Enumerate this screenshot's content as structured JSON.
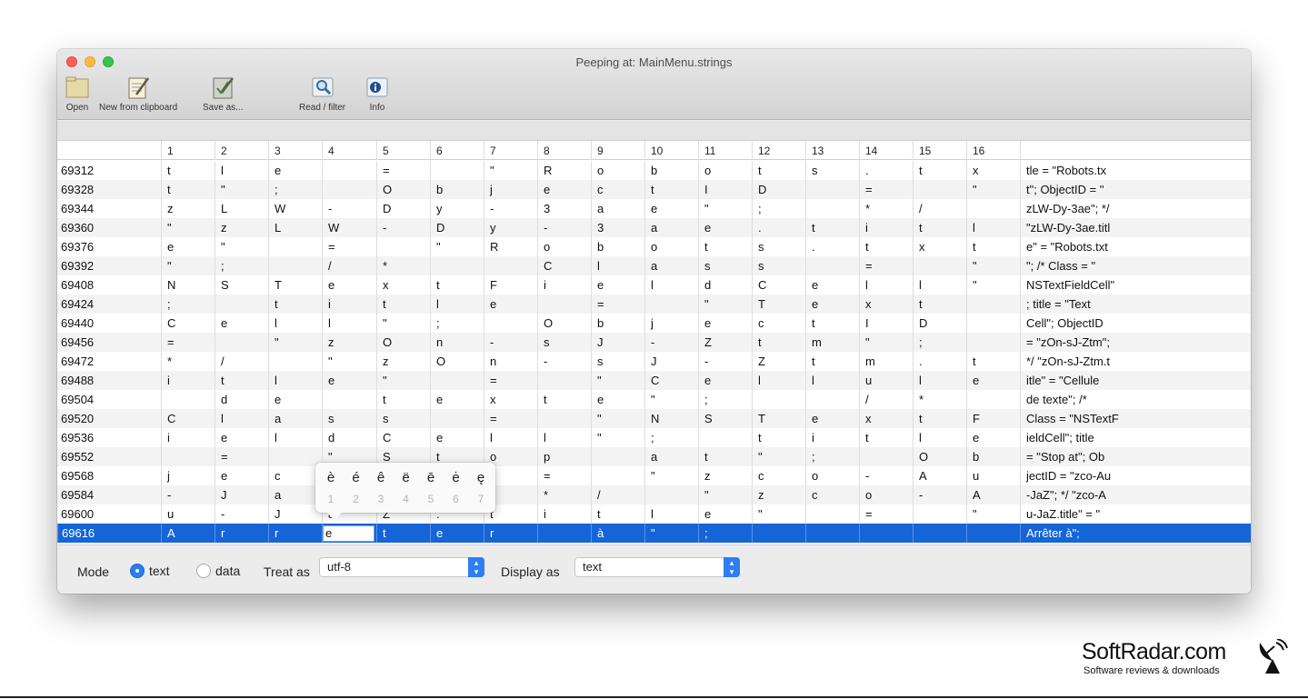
{
  "window": {
    "title": "Peeping at: MainMenu.strings"
  },
  "toolbar": [
    {
      "label": "Open",
      "icon": "folder-icon"
    },
    {
      "label": "New from clipboard",
      "icon": "new-note-icon"
    },
    {
      "label": "Save as...",
      "icon": "save-note-icon"
    },
    {
      "label": "Read / filter",
      "icon": "magnifier-icon"
    },
    {
      "label": "Info",
      "icon": "info-icon"
    }
  ],
  "table": {
    "columns": [
      "",
      "1",
      "2",
      "3",
      "4",
      "5",
      "6",
      "7",
      "8",
      "9",
      "10",
      "11",
      "12",
      "13",
      "14",
      "15",
      "16",
      ""
    ],
    "rows": [
      {
        "offset": "69312",
        "bytes": [
          "t",
          "l",
          "e",
          "",
          "=",
          "",
          "\"",
          "R",
          "o",
          "b",
          "o",
          "t",
          "s",
          ".",
          "t",
          "x"
        ],
        "text": "tle = \"Robots.tx"
      },
      {
        "offset": "69328",
        "bytes": [
          "t",
          "\"",
          ";",
          "",
          "O",
          "b",
          "j",
          "e",
          "c",
          "t",
          "I",
          "D",
          "",
          "=",
          "",
          "\""
        ],
        "text": "t\"; ObjectID = \""
      },
      {
        "offset": "69344",
        "bytes": [
          "z",
          "L",
          "W",
          "-",
          "D",
          "y",
          "-",
          "3",
          "a",
          "e",
          "\"",
          ";",
          "",
          "*",
          "/",
          ""
        ],
        "text": "zLW-Dy-3ae\"; */"
      },
      {
        "offset": "69360",
        "bytes": [
          "\"",
          "z",
          "L",
          "W",
          "-",
          "D",
          "y",
          "-",
          "3",
          "a",
          "e",
          ".",
          "t",
          "i",
          "t",
          "l"
        ],
        "text": "\"zLW-Dy-3ae.titl"
      },
      {
        "offset": "69376",
        "bytes": [
          "e",
          "\"",
          "",
          "=",
          "",
          "\"",
          "R",
          "o",
          "b",
          "o",
          "t",
          "s",
          ".",
          "t",
          "x",
          "t"
        ],
        "text": "e\" = \"Robots.txt"
      },
      {
        "offset": "69392",
        "bytes": [
          "\"",
          ";",
          "",
          "/",
          "*",
          "",
          "",
          "C",
          "l",
          "a",
          "s",
          "s",
          "",
          "=",
          "",
          "\""
        ],
        "text": "\";  /* Class = \""
      },
      {
        "offset": "69408",
        "bytes": [
          "N",
          "S",
          "T",
          "e",
          "x",
          "t",
          "F",
          "i",
          "e",
          "l",
          "d",
          "C",
          "e",
          "l",
          "l",
          "\""
        ],
        "text": "NSTextFieldCell\""
      },
      {
        "offset": "69424",
        "bytes": [
          ";",
          "",
          "t",
          "i",
          "t",
          "l",
          "e",
          "",
          "=",
          "",
          "\"",
          "T",
          "e",
          "x",
          "t",
          ""
        ],
        "text": "; title = \"Text"
      },
      {
        "offset": "69440",
        "bytes": [
          "C",
          "e",
          "l",
          "l",
          "\"",
          ";",
          "",
          "O",
          "b",
          "j",
          "e",
          "c",
          "t",
          "I",
          "D",
          ""
        ],
        "text": "Cell\"; ObjectID"
      },
      {
        "offset": "69456",
        "bytes": [
          "=",
          "",
          "\"",
          "z",
          "O",
          "n",
          "-",
          "s",
          "J",
          "-",
          "Z",
          "t",
          "m",
          "\"",
          ";",
          ""
        ],
        "text": "= \"zOn-sJ-Ztm\";"
      },
      {
        "offset": "69472",
        "bytes": [
          "*",
          "/",
          "",
          "\"",
          "z",
          "O",
          "n",
          "-",
          "s",
          "J",
          "-",
          "Z",
          "t",
          "m",
          ".",
          "t"
        ],
        "text": "*/ \"zOn-sJ-Ztm.t"
      },
      {
        "offset": "69488",
        "bytes": [
          "i",
          "t",
          "l",
          "e",
          "\"",
          "",
          "=",
          "",
          "\"",
          "C",
          "e",
          "l",
          "l",
          "u",
          "l",
          "e"
        ],
        "text": "itle\" = \"Cellule"
      },
      {
        "offset": "69504",
        "bytes": [
          "",
          "d",
          "e",
          "",
          "t",
          "e",
          "x",
          "t",
          "e",
          "\"",
          ";",
          "",
          "",
          "/",
          "*",
          ""
        ],
        "text": " de texte\";  /*"
      },
      {
        "offset": "69520",
        "bytes": [
          "C",
          "l",
          "a",
          "s",
          "s",
          "",
          "=",
          "",
          "\"",
          "N",
          "S",
          "T",
          "e",
          "x",
          "t",
          "F"
        ],
        "text": "Class = \"NSTextF"
      },
      {
        "offset": "69536",
        "bytes": [
          "i",
          "e",
          "l",
          "d",
          "C",
          "e",
          "l",
          "l",
          "\"",
          ";",
          "",
          "t",
          "i",
          "t",
          "l",
          "e"
        ],
        "text": "ieldCell\"; title"
      },
      {
        "offset": "69552",
        "bytes": [
          "",
          "=",
          "",
          "\"",
          "S",
          "t",
          "o",
          "p",
          "",
          "a",
          "t",
          "\"",
          ";",
          "",
          "O",
          "b"
        ],
        "text": " = \"Stop at\"; Ob"
      },
      {
        "offset": "69568",
        "bytes": [
          "j",
          "e",
          "c",
          "t",
          "I",
          "D",
          "",
          "=",
          "",
          "\"",
          "z",
          "c",
          "o",
          "-",
          "A",
          "u"
        ],
        "text": "jectID = \"zco-Au"
      },
      {
        "offset": "69584",
        "bytes": [
          "-",
          "J",
          "a",
          "Z",
          "\"",
          ";",
          "",
          "*",
          "/",
          "",
          "\"",
          "z",
          "c",
          "o",
          "-",
          "A"
        ],
        "text": "-JaZ\"; */ \"zco-A"
      },
      {
        "offset": "69600",
        "bytes": [
          "u",
          "-",
          "J",
          "a",
          "Z",
          ".",
          "t",
          "i",
          "t",
          "l",
          "e",
          "\"",
          "",
          "=",
          "",
          "\""
        ],
        "text": "u-JaZ.title\" = \""
      },
      {
        "offset": "69616",
        "bytes": [
          "A",
          "r",
          "r",
          "e",
          "t",
          "e",
          "r",
          "",
          "à",
          "\"",
          ";",
          "",
          "",
          "",
          "",
          ""
        ],
        "text": "Arrêter à\";"
      }
    ]
  },
  "accent_popup": {
    "chars": [
      "è",
      "é",
      "ê",
      "ë",
      "ē",
      "ė",
      "ę"
    ],
    "keys": [
      "1",
      "2",
      "3",
      "4",
      "5",
      "6",
      "7"
    ]
  },
  "controls": {
    "mode_label": "Mode",
    "radio_text": "text",
    "radio_data": "data",
    "mode_selected": "text",
    "treat_as_label": "Treat as",
    "treat_as_value": "utf-8",
    "display_as_label": "Display as",
    "display_as_value": "text"
  },
  "colors": {
    "selection": "#1665d8",
    "accent": "#2e7df2"
  },
  "brand": {
    "name": "SoftRadar.com",
    "tagline": "Software reviews & downloads"
  }
}
